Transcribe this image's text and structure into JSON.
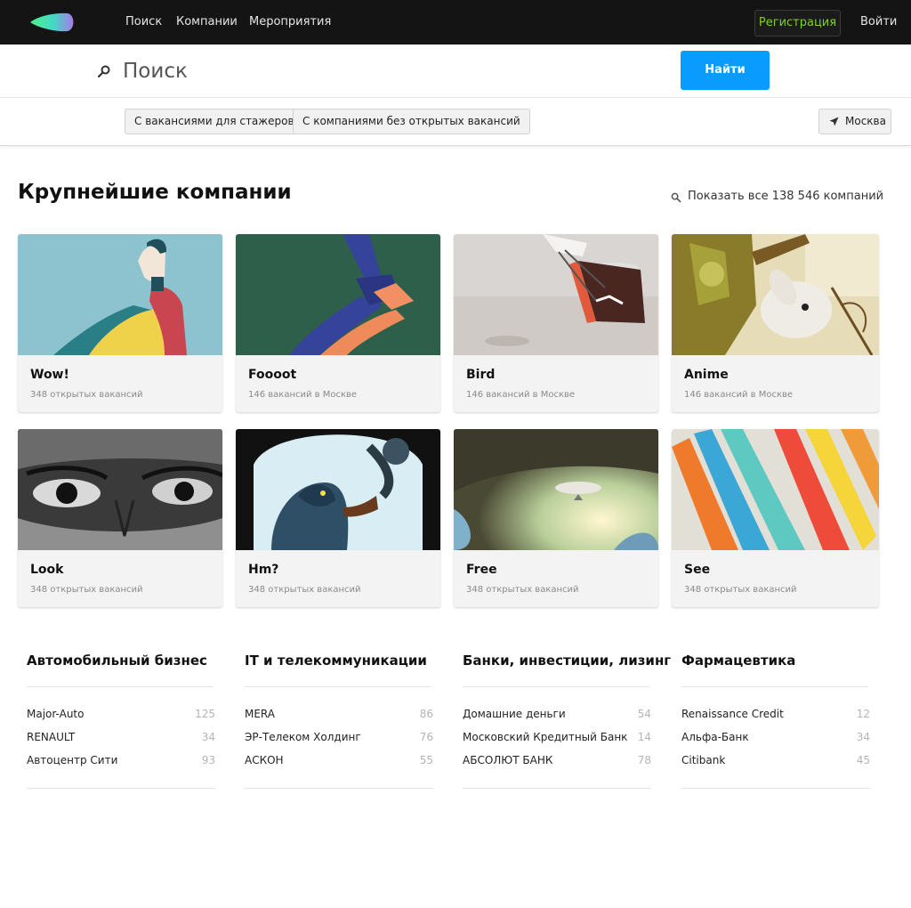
{
  "nav": {
    "links": [
      "Поиск",
      "Компании",
      "Мероприятия"
    ],
    "register": "Регистрация",
    "login": "Войти"
  },
  "search": {
    "placeholder": "Поиск",
    "button": "Найти"
  },
  "filters": {
    "chips": [
      "С вакансиями для стажеров",
      "С компаниями без открытых вакансий"
    ],
    "city": "Москва"
  },
  "companies_section": {
    "title": "Крупнейшие компании",
    "show_all": "Показать все 138 546 компаний"
  },
  "companies": [
    {
      "name": "Wow!",
      "vacancies": "348 открытых вакансий"
    },
    {
      "name": "Foooot",
      "vacancies": "146 вакансий в Москве"
    },
    {
      "name": "Bird",
      "vacancies": "146 вакансий в Москве"
    },
    {
      "name": "Anime",
      "vacancies": "146 вакансий в Москве"
    },
    {
      "name": "Look",
      "vacancies": "348 открытых вакансий"
    },
    {
      "name": "Hm?",
      "vacancies": "348 открытых вакансий"
    },
    {
      "name": "Free",
      "vacancies": "348 открытых вакансий"
    },
    {
      "name": "See",
      "vacancies": "348 открытых вакансий"
    }
  ],
  "industries": [
    {
      "title": "Автомобильный бизнес",
      "items": [
        {
          "name": "Major-Auto",
          "count": "125"
        },
        {
          "name": "RENAULT",
          "count": "34"
        },
        {
          "name": "Автоцентр Сити",
          "count": "93"
        }
      ]
    },
    {
      "title": "IT и телекоммуникации",
      "items": [
        {
          "name": "MERA",
          "count": "86"
        },
        {
          "name": "ЭР-Телеком Холдинг",
          "count": "76"
        },
        {
          "name": "АСКОН",
          "count": "55"
        }
      ]
    },
    {
      "title": "Банки, инвестиции, лизинг",
      "items": [
        {
          "name": "Домашние деньги",
          "count": "54"
        },
        {
          "name": "Московский Кредитный Банк",
          "count": "14"
        },
        {
          "name": "АБСОЛЮТ БАНК",
          "count": "78"
        }
      ]
    },
    {
      "title": "Фармацевтика",
      "items": [
        {
          "name": "Renaissance Credit",
          "count": "12"
        },
        {
          "name": "Альфа-Банк",
          "count": "34"
        },
        {
          "name": "Citibank",
          "count": "45"
        }
      ]
    }
  ],
  "colors": {
    "topbar": "#141414",
    "accent_blue": "#0a9bff",
    "register_green": "#7ed321"
  }
}
